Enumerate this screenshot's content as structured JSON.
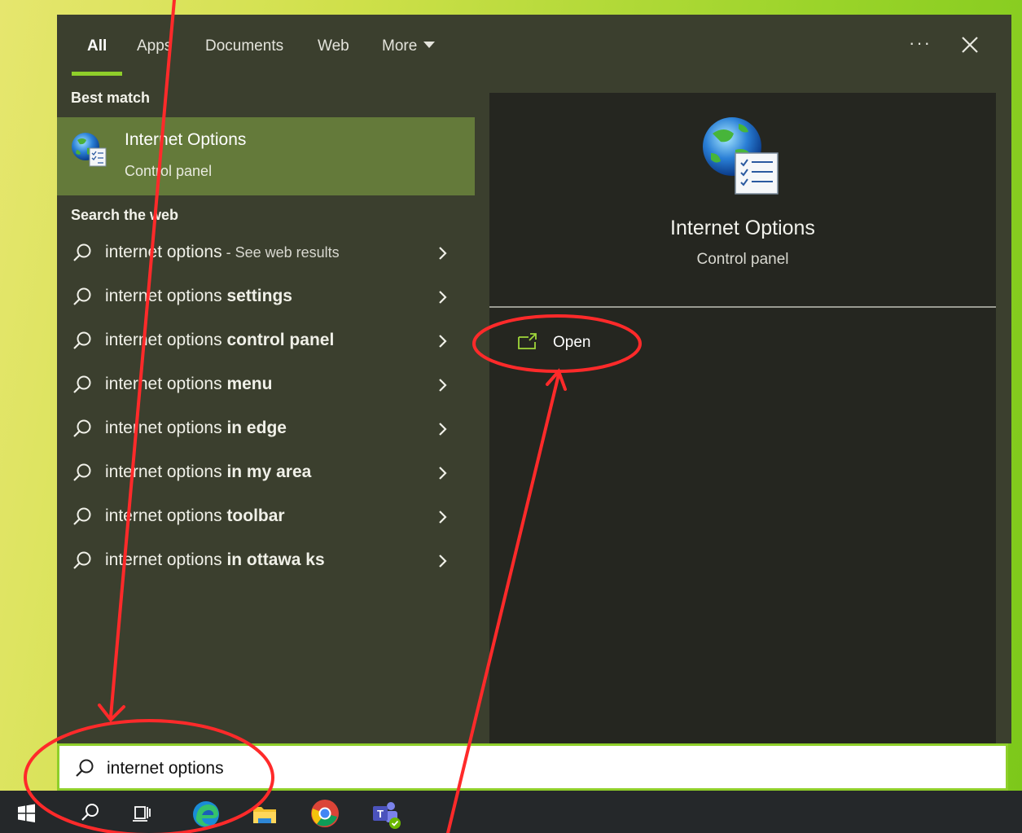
{
  "tabs": [
    {
      "label": "All",
      "active": true
    },
    {
      "label": "Apps"
    },
    {
      "label": "Documents"
    },
    {
      "label": "Web"
    },
    {
      "label": "More"
    }
  ],
  "controls": {
    "ellipsis": "···"
  },
  "best_match": {
    "section_label": "Best match",
    "title": "Internet Options",
    "subtitle": "Control panel",
    "icon": "internet-options-icon"
  },
  "search_web": {
    "section_label": "Search the web",
    "items": [
      {
        "prefix": "internet options",
        "bold": "",
        "suffix": " - See web results"
      },
      {
        "prefix": "internet options ",
        "bold": "settings",
        "suffix": ""
      },
      {
        "prefix": "internet options ",
        "bold": "control panel",
        "suffix": ""
      },
      {
        "prefix": "internet options ",
        "bold": "menu",
        "suffix": ""
      },
      {
        "prefix": "internet options ",
        "bold": "in edge",
        "suffix": ""
      },
      {
        "prefix": "internet options ",
        "bold": "in my area",
        "suffix": ""
      },
      {
        "prefix": "internet options ",
        "bold": "toolbar",
        "suffix": ""
      },
      {
        "prefix": "internet options ",
        "bold": "in ottawa ks",
        "suffix": ""
      }
    ]
  },
  "preview": {
    "title": "Internet Options",
    "subtitle": "Control panel",
    "actions": [
      {
        "label": "Open",
        "icon": "open-icon"
      }
    ]
  },
  "search_box": {
    "value": "internet options"
  },
  "taskbar": {
    "items": [
      "start-icon",
      "search-icon",
      "task-view-icon",
      "edge-icon",
      "file-explorer-icon",
      "chrome-icon",
      "teams-icon"
    ]
  },
  "colors": {
    "accent": "#8fcf2a",
    "selection": "#647a3a",
    "annotation": "#ff2a2a"
  }
}
